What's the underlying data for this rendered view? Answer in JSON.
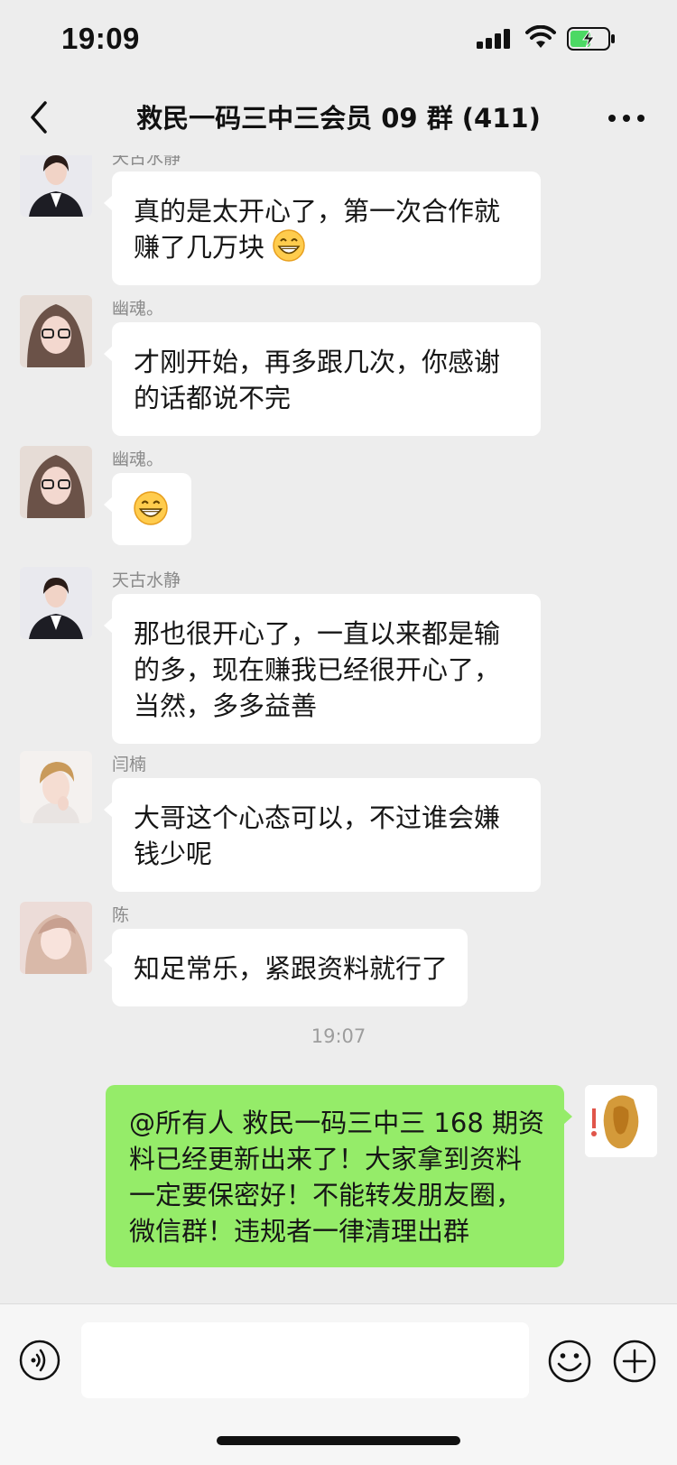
{
  "status_bar": {
    "time": "19:09"
  },
  "nav": {
    "title": "救民一码三中三会员 09 群 (411)"
  },
  "messages": [
    {
      "sender": "天古水静",
      "text": "真的是太开心了，第一次合作就赚了几万块",
      "emoji": "grinning-face-icon"
    },
    {
      "sender": "幽魂。",
      "text": "才刚开始，再多跟几次，你感谢的话都说不完"
    },
    {
      "sender": "幽魂。",
      "text": "",
      "emoji": "grinning-face-icon"
    },
    {
      "sender": "天古水静",
      "text": "那也很开心了，一直以来都是输的多，现在赚我已经很开心了，当然，多多益善"
    },
    {
      "sender": "闫楠",
      "text": "大哥这个心态可以，不过谁会嫌钱少呢"
    },
    {
      "sender": "陈",
      "text": "知足常乐，紧跟资料就行了"
    }
  ],
  "timestamp": "19:07",
  "self_message": {
    "text": "@所有人  救民一码三中三 168 期资料已经更新出来了！大家拿到资料一定要保密好！不能转发朋友圈，微信群！违规者一律清理出群"
  },
  "input": {
    "placeholder": ""
  },
  "colors": {
    "background": "#ededed",
    "bubble_other": "#ffffff",
    "bubble_self": "#95ec69",
    "battery": "#4cd964"
  }
}
